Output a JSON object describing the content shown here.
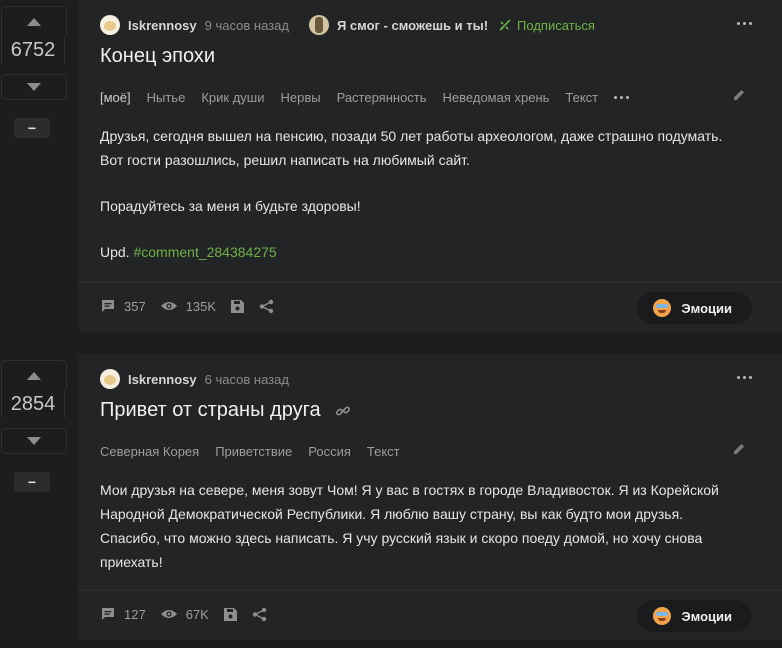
{
  "posts": [
    {
      "rating": "6752",
      "minus_label": "−",
      "author": "Iskrennosy",
      "time": "9 часов назад",
      "community": "Я смог - сможешь и ты!",
      "subscribe": "Подписаться",
      "title": "Конец эпохи",
      "tags": [
        "[моё]",
        "Нытье",
        "Крик души",
        "Нервы",
        "Растерянность",
        "Неведомая хрень",
        "Текст"
      ],
      "body_lines": [
        "Друзья, сегодня вышел на пенсию, позади 50 лет работы археологом, даже страшно подумать.",
        "Вот гости разошлись, решил написать на любимый сайт.",
        "Порадуйтесь за меня и будьте здоровы!"
      ],
      "upd_label": "Upd.",
      "upd_link": "#comment_284384275",
      "comments": "357",
      "views": "135K",
      "emotions_label": "Эмоции"
    },
    {
      "rating": "2854",
      "minus_label": "−",
      "author": "Iskrennosy",
      "time": "6 часов назад",
      "title": "Привет от страны друга",
      "tags": [
        "Северная Корея",
        "Приветствие",
        "Россия",
        "Текст"
      ],
      "body_lines": [
        "Мои друзья на севере, меня зовут Чом! Я у вас в гостях в городе Владивосток. Я из Корейской",
        "Народной Демократической Республики. Я люблю вашу страну, вы как будто мои друзья.",
        "Спасибо, что можно здесь написать. Я учу русский язык и скоро поеду домой, но хочу снова",
        "приехать!"
      ],
      "comments": "127",
      "views": "67K",
      "emotions_label": "Эмоции"
    }
  ],
  "colors": {
    "accent": "#6eb246",
    "background": "#1c1d1f",
    "card": "#232426"
  },
  "icons": [
    "arrow-up-icon",
    "arrow-down-icon",
    "comment-icon",
    "eye-icon",
    "save-icon",
    "share-icon",
    "pencil-icon",
    "link-icon",
    "more-icon"
  ]
}
